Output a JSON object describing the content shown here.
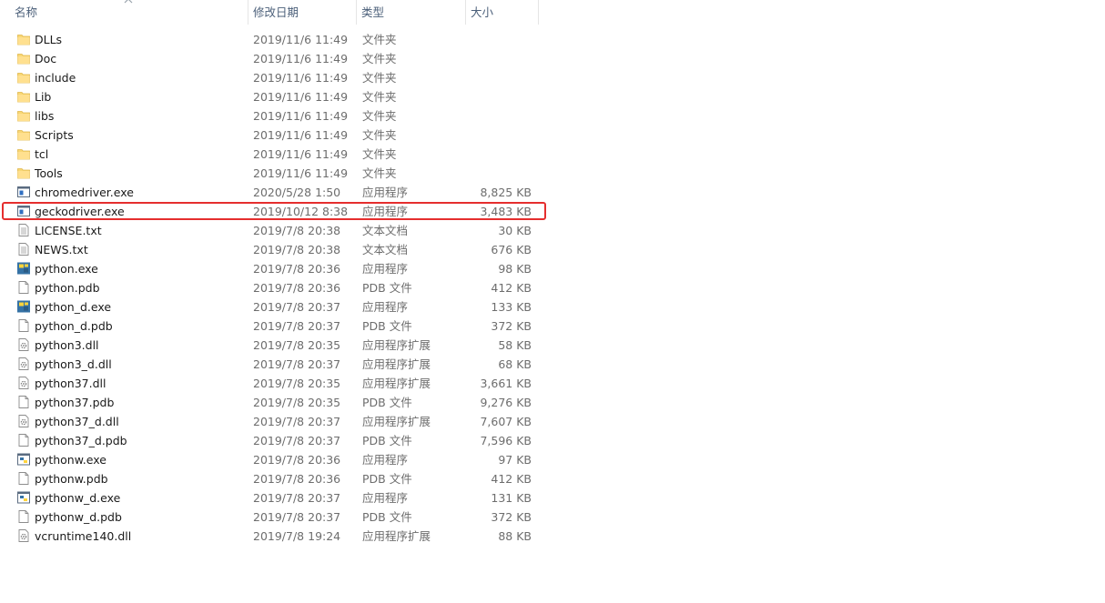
{
  "header": {
    "col_name": "名称",
    "col_date": "修改日期",
    "col_type": "类型",
    "col_size": "大小"
  },
  "colors": {
    "highlight": "#e52e2e",
    "folder": "#f8d775",
    "header_text": "#4c607a"
  },
  "files": [
    {
      "name": "DLLs",
      "date": "2019/11/6 11:49",
      "type": "文件夹",
      "size": "",
      "icon": "folder-icon"
    },
    {
      "name": "Doc",
      "date": "2019/11/6 11:49",
      "type": "文件夹",
      "size": "",
      "icon": "folder-icon"
    },
    {
      "name": "include",
      "date": "2019/11/6 11:49",
      "type": "文件夹",
      "size": "",
      "icon": "folder-icon"
    },
    {
      "name": "Lib",
      "date": "2019/11/6 11:49",
      "type": "文件夹",
      "size": "",
      "icon": "folder-icon"
    },
    {
      "name": "libs",
      "date": "2019/11/6 11:49",
      "type": "文件夹",
      "size": "",
      "icon": "folder-icon"
    },
    {
      "name": "Scripts",
      "date": "2019/11/6 11:49",
      "type": "文件夹",
      "size": "",
      "icon": "folder-icon"
    },
    {
      "name": "tcl",
      "date": "2019/11/6 11:49",
      "type": "文件夹",
      "size": "",
      "icon": "folder-icon"
    },
    {
      "name": "Tools",
      "date": "2019/11/6 11:49",
      "type": "文件夹",
      "size": "",
      "icon": "folder-icon"
    },
    {
      "name": "chromedriver.exe",
      "date": "2020/5/28 1:50",
      "type": "应用程序",
      "size": "8,825 KB",
      "icon": "exe-icon"
    },
    {
      "name": "geckodriver.exe",
      "date": "2019/10/12 8:38",
      "type": "应用程序",
      "size": "3,483 KB",
      "icon": "exe-icon"
    },
    {
      "name": "LICENSE.txt",
      "date": "2019/7/8 20:38",
      "type": "文本文档",
      "size": "30 KB",
      "icon": "text-file-icon"
    },
    {
      "name": "NEWS.txt",
      "date": "2019/7/8 20:38",
      "type": "文本文档",
      "size": "676 KB",
      "icon": "text-file-icon"
    },
    {
      "name": "python.exe",
      "date": "2019/7/8 20:36",
      "type": "应用程序",
      "size": "98 KB",
      "icon": "python-icon"
    },
    {
      "name": "python.pdb",
      "date": "2019/7/8 20:36",
      "type": "PDB 文件",
      "size": "412 KB",
      "icon": "blank-file-icon"
    },
    {
      "name": "python_d.exe",
      "date": "2019/7/8 20:37",
      "type": "应用程序",
      "size": "133 KB",
      "icon": "python-icon"
    },
    {
      "name": "python_d.pdb",
      "date": "2019/7/8 20:37",
      "type": "PDB 文件",
      "size": "372 KB",
      "icon": "blank-file-icon"
    },
    {
      "name": "python3.dll",
      "date": "2019/7/8 20:35",
      "type": "应用程序扩展",
      "size": "58 KB",
      "icon": "dll-icon"
    },
    {
      "name": "python3_d.dll",
      "date": "2019/7/8 20:37",
      "type": "应用程序扩展",
      "size": "68 KB",
      "icon": "dll-icon"
    },
    {
      "name": "python37.dll",
      "date": "2019/7/8 20:35",
      "type": "应用程序扩展",
      "size": "3,661 KB",
      "icon": "dll-icon"
    },
    {
      "name": "python37.pdb",
      "date": "2019/7/8 20:35",
      "type": "PDB 文件",
      "size": "9,276 KB",
      "icon": "blank-file-icon"
    },
    {
      "name": "python37_d.dll",
      "date": "2019/7/8 20:37",
      "type": "应用程序扩展",
      "size": "7,607 KB",
      "icon": "dll-icon"
    },
    {
      "name": "python37_d.pdb",
      "date": "2019/7/8 20:37",
      "type": "PDB 文件",
      "size": "7,596 KB",
      "icon": "blank-file-icon"
    },
    {
      "name": "pythonw.exe",
      "date": "2019/7/8 20:36",
      "type": "应用程序",
      "size": "97 KB",
      "icon": "pythonw-icon"
    },
    {
      "name": "pythonw.pdb",
      "date": "2019/7/8 20:36",
      "type": "PDB 文件",
      "size": "412 KB",
      "icon": "blank-file-icon"
    },
    {
      "name": "pythonw_d.exe",
      "date": "2019/7/8 20:37",
      "type": "应用程序",
      "size": "131 KB",
      "icon": "pythonw-icon"
    },
    {
      "name": "pythonw_d.pdb",
      "date": "2019/7/8 20:37",
      "type": "PDB 文件",
      "size": "372 KB",
      "icon": "blank-file-icon"
    },
    {
      "name": "vcruntime140.dll",
      "date": "2019/7/8 19:24",
      "type": "应用程序扩展",
      "size": "88 KB",
      "icon": "dll-icon"
    }
  ],
  "highlighted_file": "geckodriver.exe"
}
